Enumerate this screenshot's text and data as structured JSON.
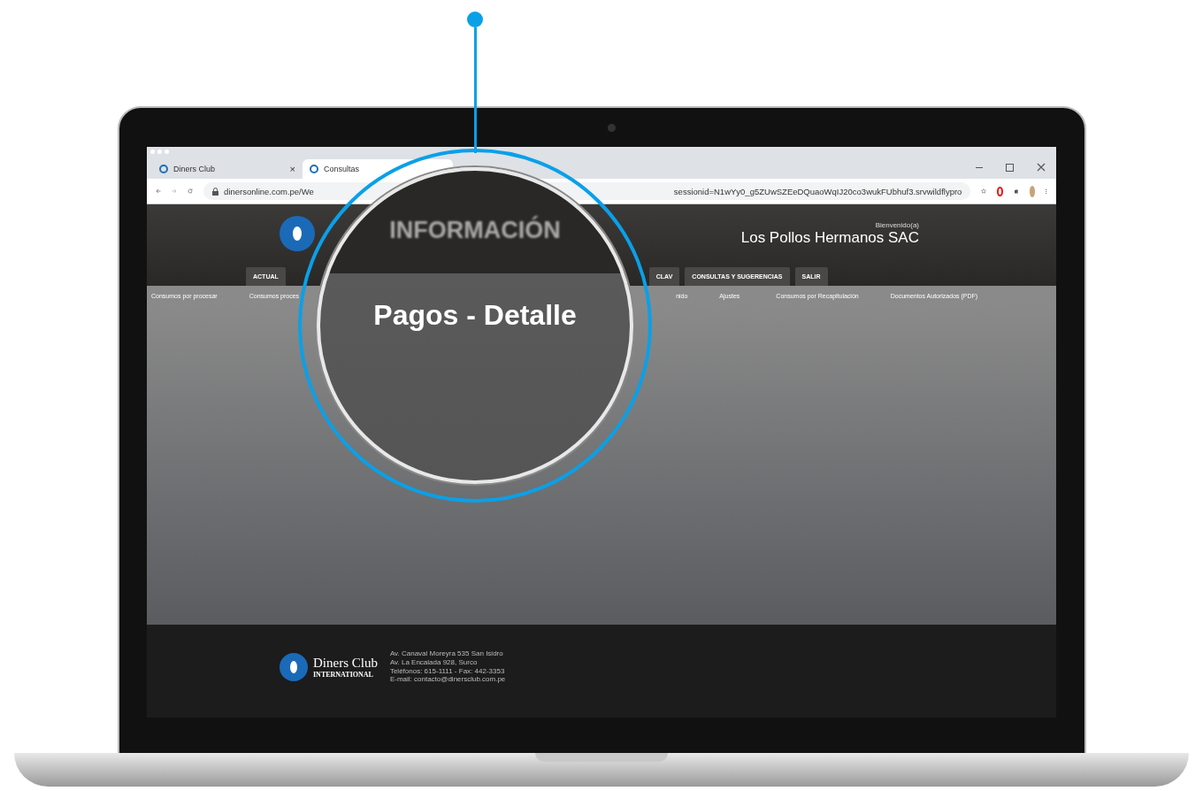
{
  "browser": {
    "tabs": [
      {
        "label": "Diners Club",
        "close": "×",
        "selected": false
      },
      {
        "label": "Consultas",
        "selected": true
      }
    ],
    "url_left": "dinersonline.com.pe/We",
    "url_right": "sessionid=N1wYy0_g5ZUwSZEeDQuaoWqIJ20co3wukFUbhuf3.srvwildflypro"
  },
  "header": {
    "welcome": "Bienvenido(a)",
    "company": "Los Pollos Hermanos SAC"
  },
  "nav": [
    {
      "label": "ACTUAL"
    },
    {
      "label": "CLAV"
    },
    {
      "label": "CONSULTAS Y SUGERENCIAS"
    },
    {
      "label": "SALIR"
    }
  ],
  "subnav": [
    {
      "label": "Consumos por procesar"
    },
    {
      "label": "Consumos proces"
    },
    {
      "label": "nido"
    },
    {
      "label": "Ajustes"
    },
    {
      "label": "Consumos por Recapitulación"
    },
    {
      "label": "Documentos Autorizados (PDF)"
    }
  ],
  "magnifier": {
    "heading": "INFORMACIÓN",
    "title": "Pagos - Detalle"
  },
  "footer": {
    "brand": "Diners Club",
    "brand_sub": "INTERNATIONAL",
    "address": [
      "Av. Canaval Moreyra 535 San Isidro",
      "Av. La Encalada 928, Surco",
      "Teléfonos: 615-1111 - Fax: 442-3353",
      "E-mail: contacto@dinersclub.com.pe"
    ]
  }
}
